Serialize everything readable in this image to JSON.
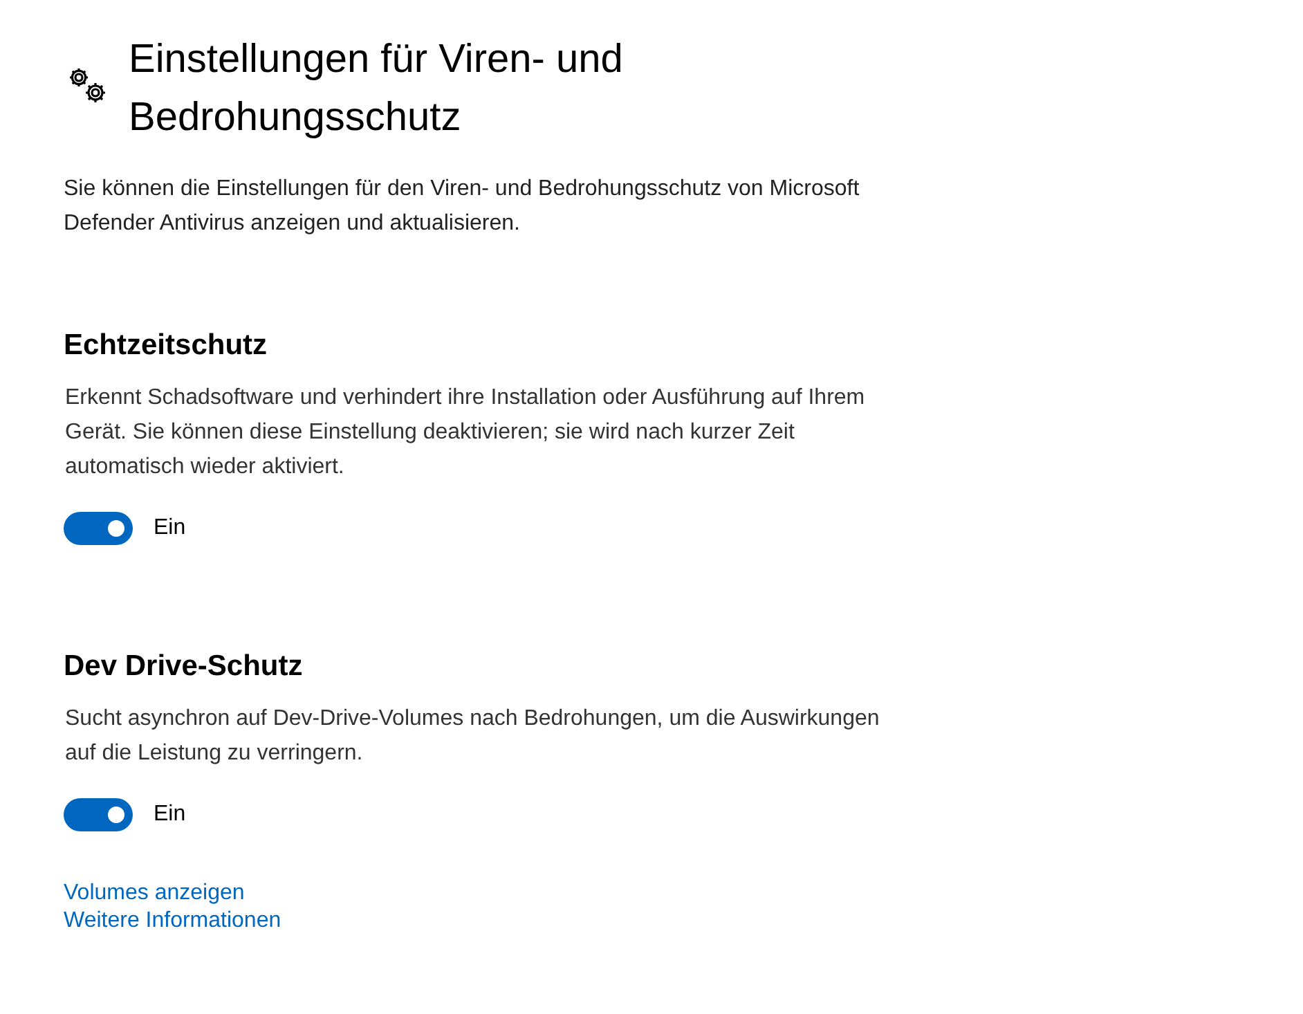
{
  "page": {
    "title": "Einstellungen für Viren- und Bedrohungsschutz",
    "description": "Sie können die Einstellungen für den Viren- und Bedrohungsschutz von Microsoft Defender Antivirus anzeigen und aktualisieren."
  },
  "sections": [
    {
      "heading": "Echtzeitschutz",
      "description": "Erkennt Schadsoftware und verhindert ihre Installation oder Ausführung auf Ihrem Gerät. Sie können diese Einstellung deaktivieren; sie wird nach kurzer Zeit automatisch wieder aktiviert.",
      "toggle": {
        "on": true,
        "label": "Ein"
      }
    },
    {
      "heading": "Dev Drive-Schutz",
      "description": "Sucht asynchron auf Dev-Drive-Volumes nach Bedrohungen, um die Auswirkungen auf die Leistung zu verringern.",
      "toggle": {
        "on": true,
        "label": "Ein"
      }
    }
  ],
  "links": [
    "Volumes anzeigen",
    "Weitere Informationen"
  ]
}
